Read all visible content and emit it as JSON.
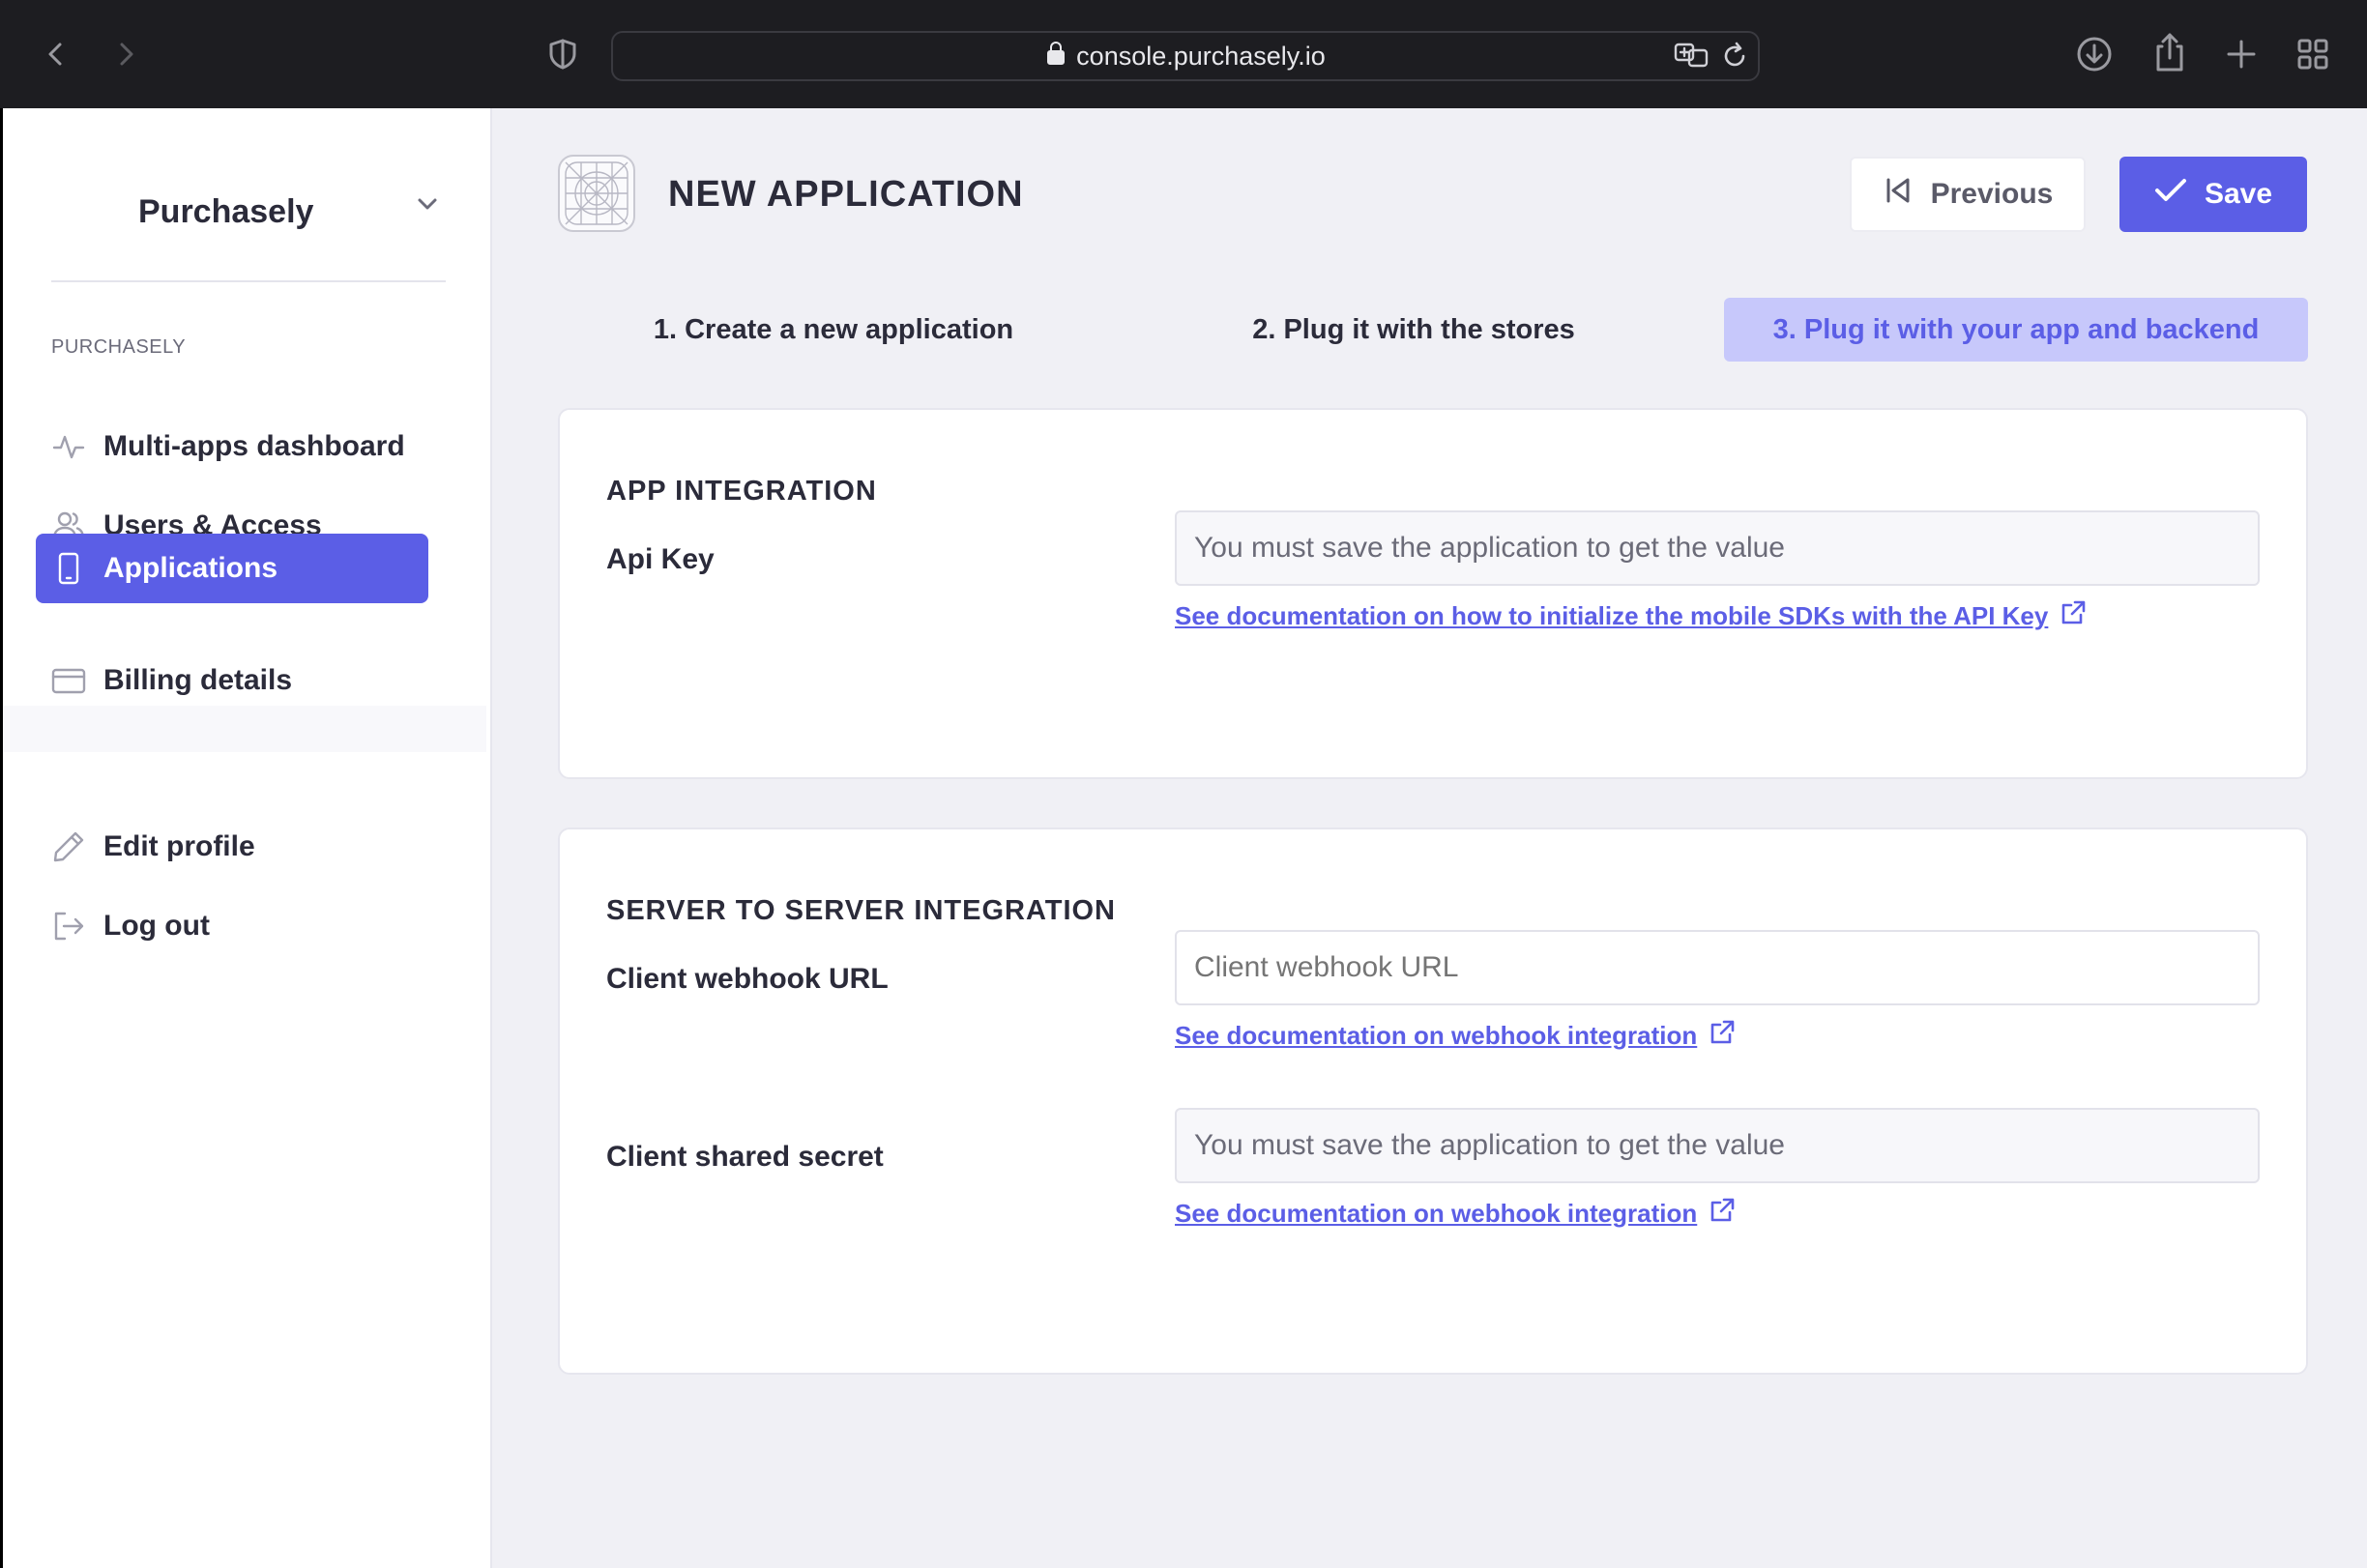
{
  "browser": {
    "url": "console.purchasely.io"
  },
  "sidebar": {
    "org_name": "Purchasely",
    "section_label": "PURCHASELY",
    "items": [
      {
        "label": "Multi-apps dashboard",
        "icon": "activity-icon",
        "active": false
      },
      {
        "label": "Users & Access",
        "icon": "users-icon",
        "active": false
      },
      {
        "label": "Applications",
        "icon": "smartphone-icon",
        "active": true
      },
      {
        "label": "Billing details",
        "icon": "credit-card-icon",
        "active": false
      }
    ],
    "bottom_items": [
      {
        "label": "Edit profile",
        "icon": "pencil-icon"
      },
      {
        "label": "Log out",
        "icon": "log-out-icon"
      }
    ]
  },
  "header": {
    "title": "NEW APPLICATION",
    "previous_label": "Previous",
    "save_label": "Save"
  },
  "steps": [
    {
      "label": "1. Create a new application",
      "active": false
    },
    {
      "label": "2. Plug it with the stores",
      "active": false
    },
    {
      "label": "3. Plug it with your app and backend",
      "active": true
    }
  ],
  "app_integration": {
    "title": "APP INTEGRATION",
    "api_key_label": "Api Key",
    "api_key_value": "You must save the application to get the value",
    "api_key_link": "See documentation on how to initialize the mobile SDKs with the API Key"
  },
  "server_integration": {
    "title": "SERVER TO SERVER INTEGRATION",
    "webhook_label": "Client webhook URL",
    "webhook_placeholder": "Client webhook URL",
    "webhook_link": "See documentation on webhook integration",
    "secret_label": "Client shared secret",
    "secret_value": "You must save the application to get the value",
    "secret_link": "See documentation on webhook integration"
  },
  "colors": {
    "accent": "#5b5ee6",
    "accent_light": "#c7c8fb",
    "background": "#f0f0f5"
  }
}
